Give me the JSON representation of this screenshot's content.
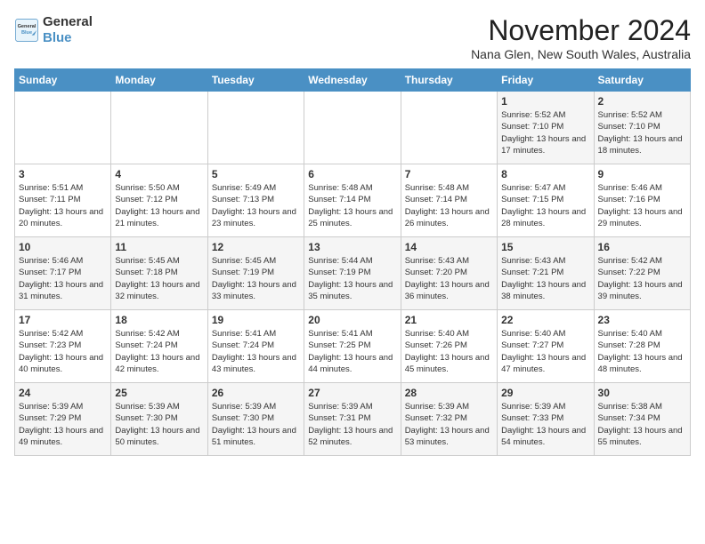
{
  "logo": {
    "line1": "General",
    "line2": "Blue"
  },
  "title": "November 2024",
  "location": "Nana Glen, New South Wales, Australia",
  "days_of_week": [
    "Sunday",
    "Monday",
    "Tuesday",
    "Wednesday",
    "Thursday",
    "Friday",
    "Saturday"
  ],
  "weeks": [
    [
      {
        "day": "",
        "info": ""
      },
      {
        "day": "",
        "info": ""
      },
      {
        "day": "",
        "info": ""
      },
      {
        "day": "",
        "info": ""
      },
      {
        "day": "",
        "info": ""
      },
      {
        "day": "1",
        "info": "Sunrise: 5:52 AM\nSunset: 7:10 PM\nDaylight: 13 hours and 17 minutes."
      },
      {
        "day": "2",
        "info": "Sunrise: 5:52 AM\nSunset: 7:10 PM\nDaylight: 13 hours and 18 minutes."
      }
    ],
    [
      {
        "day": "3",
        "info": "Sunrise: 5:51 AM\nSunset: 7:11 PM\nDaylight: 13 hours and 20 minutes."
      },
      {
        "day": "4",
        "info": "Sunrise: 5:50 AM\nSunset: 7:12 PM\nDaylight: 13 hours and 21 minutes."
      },
      {
        "day": "5",
        "info": "Sunrise: 5:49 AM\nSunset: 7:13 PM\nDaylight: 13 hours and 23 minutes."
      },
      {
        "day": "6",
        "info": "Sunrise: 5:48 AM\nSunset: 7:14 PM\nDaylight: 13 hours and 25 minutes."
      },
      {
        "day": "7",
        "info": "Sunrise: 5:48 AM\nSunset: 7:14 PM\nDaylight: 13 hours and 26 minutes."
      },
      {
        "day": "8",
        "info": "Sunrise: 5:47 AM\nSunset: 7:15 PM\nDaylight: 13 hours and 28 minutes."
      },
      {
        "day": "9",
        "info": "Sunrise: 5:46 AM\nSunset: 7:16 PM\nDaylight: 13 hours and 29 minutes."
      }
    ],
    [
      {
        "day": "10",
        "info": "Sunrise: 5:46 AM\nSunset: 7:17 PM\nDaylight: 13 hours and 31 minutes."
      },
      {
        "day": "11",
        "info": "Sunrise: 5:45 AM\nSunset: 7:18 PM\nDaylight: 13 hours and 32 minutes."
      },
      {
        "day": "12",
        "info": "Sunrise: 5:45 AM\nSunset: 7:19 PM\nDaylight: 13 hours and 33 minutes."
      },
      {
        "day": "13",
        "info": "Sunrise: 5:44 AM\nSunset: 7:19 PM\nDaylight: 13 hours and 35 minutes."
      },
      {
        "day": "14",
        "info": "Sunrise: 5:43 AM\nSunset: 7:20 PM\nDaylight: 13 hours and 36 minutes."
      },
      {
        "day": "15",
        "info": "Sunrise: 5:43 AM\nSunset: 7:21 PM\nDaylight: 13 hours and 38 minutes."
      },
      {
        "day": "16",
        "info": "Sunrise: 5:42 AM\nSunset: 7:22 PM\nDaylight: 13 hours and 39 minutes."
      }
    ],
    [
      {
        "day": "17",
        "info": "Sunrise: 5:42 AM\nSunset: 7:23 PM\nDaylight: 13 hours and 40 minutes."
      },
      {
        "day": "18",
        "info": "Sunrise: 5:42 AM\nSunset: 7:24 PM\nDaylight: 13 hours and 42 minutes."
      },
      {
        "day": "19",
        "info": "Sunrise: 5:41 AM\nSunset: 7:24 PM\nDaylight: 13 hours and 43 minutes."
      },
      {
        "day": "20",
        "info": "Sunrise: 5:41 AM\nSunset: 7:25 PM\nDaylight: 13 hours and 44 minutes."
      },
      {
        "day": "21",
        "info": "Sunrise: 5:40 AM\nSunset: 7:26 PM\nDaylight: 13 hours and 45 minutes."
      },
      {
        "day": "22",
        "info": "Sunrise: 5:40 AM\nSunset: 7:27 PM\nDaylight: 13 hours and 47 minutes."
      },
      {
        "day": "23",
        "info": "Sunrise: 5:40 AM\nSunset: 7:28 PM\nDaylight: 13 hours and 48 minutes."
      }
    ],
    [
      {
        "day": "24",
        "info": "Sunrise: 5:39 AM\nSunset: 7:29 PM\nDaylight: 13 hours and 49 minutes."
      },
      {
        "day": "25",
        "info": "Sunrise: 5:39 AM\nSunset: 7:30 PM\nDaylight: 13 hours and 50 minutes."
      },
      {
        "day": "26",
        "info": "Sunrise: 5:39 AM\nSunset: 7:30 PM\nDaylight: 13 hours and 51 minutes."
      },
      {
        "day": "27",
        "info": "Sunrise: 5:39 AM\nSunset: 7:31 PM\nDaylight: 13 hours and 52 minutes."
      },
      {
        "day": "28",
        "info": "Sunrise: 5:39 AM\nSunset: 7:32 PM\nDaylight: 13 hours and 53 minutes."
      },
      {
        "day": "29",
        "info": "Sunrise: 5:39 AM\nSunset: 7:33 PM\nDaylight: 13 hours and 54 minutes."
      },
      {
        "day": "30",
        "info": "Sunrise: 5:38 AM\nSunset: 7:34 PM\nDaylight: 13 hours and 55 minutes."
      }
    ]
  ]
}
